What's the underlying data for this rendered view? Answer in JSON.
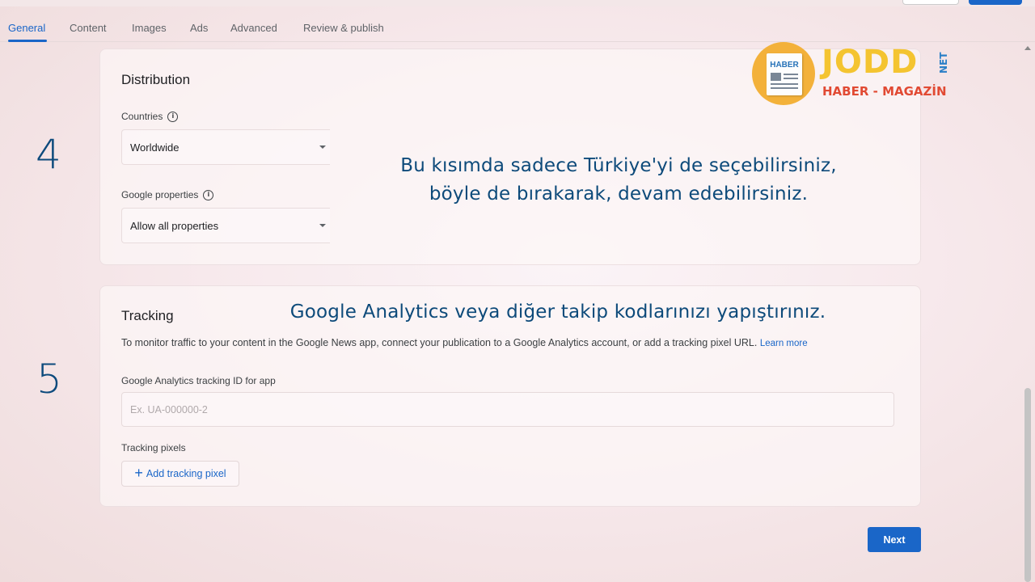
{
  "tabs": [
    {
      "label": "General",
      "active": true
    },
    {
      "label": "Content",
      "active": false
    },
    {
      "label": "Images",
      "active": false
    },
    {
      "label": "Ads",
      "active": false
    },
    {
      "label": "Advanced",
      "active": false
    },
    {
      "label": "Review & publish",
      "active": false
    }
  ],
  "distribution": {
    "title": "Distribution",
    "countries_label": "Countries",
    "countries_value": "Worldwide",
    "properties_label": "Google properties",
    "properties_value": "Allow all properties"
  },
  "tracking": {
    "title": "Tracking",
    "description": "To monitor traffic to your content in the Google News app, connect your publication to a Google Analytics account, or add a tracking pixel URL.",
    "learn_more": "Learn more",
    "analytics_label": "Google Analytics tracking ID for app",
    "analytics_placeholder": "Ex. UA-000000-2",
    "pixels_label": "Tracking pixels",
    "add_pixel_label": "Add tracking pixel"
  },
  "annotations": {
    "step4": "4",
    "step5": "5",
    "note_distribution_line1": "Bu kısımda sadece Türkiye'yi de seçebilirsiniz,",
    "note_distribution_line2": "böyle de bırakarak, devam edebilirsiniz.",
    "note_tracking": "Google Analytics veya diğer takip kodlarınızı yapıştırınız."
  },
  "logo": {
    "paper_text": "HABER",
    "brand": "JODD",
    "suffix": "NET",
    "tagline": "HABER - MAGAZİN"
  },
  "next_label": "Next",
  "colors": {
    "accent": "#1a66c8",
    "overlay_text": "#0d4a7a",
    "logo_yellow": "#f4c430",
    "logo_red": "#e14a33"
  },
  "icons": [
    "info-icon",
    "dropdown-caret-icon",
    "plus-icon",
    "newspaper-icon"
  ]
}
